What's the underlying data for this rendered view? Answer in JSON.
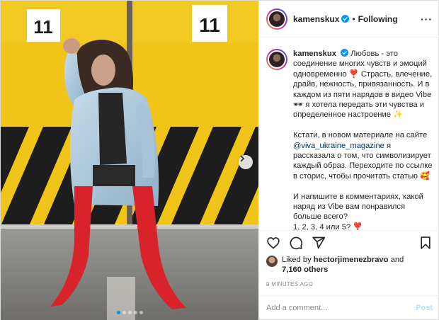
{
  "photo": {
    "sign_left": "11",
    "sign_right": "11",
    "carousel_total": 5,
    "carousel_active": 1
  },
  "header": {
    "username": "kamenskux",
    "separator": "•",
    "follow_status": "Following",
    "more_label": "···"
  },
  "caption": {
    "username": "kamenskux",
    "paragraph1": "Любовь - это соединение многих чувств и эмоций одновременно ❣️ Страсть, влечение, драйв, нежность, привязанность. И в каждом из пяти нарядов в видео Vibe 🕶 я хотела передать эти чувства и определенное настроение ✨",
    "paragraph2_before": "Кстати, в новом материале на сайте ",
    "paragraph2_mention": "@viva_ukraine_magazine",
    "paragraph2_after": " я рассказала о том, что символизирует каждый образ. Переходите по ссылке в сторис, чтобы прочитать статью 🥰",
    "paragraph3": "И напишите в комментариях, какой наряд из Vibe вам понравился больше всего?",
    "paragraph4": "1, 2, 3, 4 или 5? ❣️"
  },
  "likes": {
    "prefix": "Liked by ",
    "user": "hectorjimenezbravo",
    "conjunction": " and ",
    "others": "7,160 others"
  },
  "timestamp": "9 MINUTES AGO",
  "comment": {
    "placeholder": "Add a comment...",
    "post_label": "Post"
  },
  "icons": {
    "like": "heart-icon",
    "comment": "comment-icon",
    "share": "share-icon",
    "save": "bookmark-icon",
    "verified": "verified-badge-icon"
  },
  "colors": {
    "verified": "#0095f6",
    "mention": "#00376b",
    "post_button": "#b2dffc",
    "wall_yellow": "#f0c419",
    "boots": "#d8232a"
  }
}
